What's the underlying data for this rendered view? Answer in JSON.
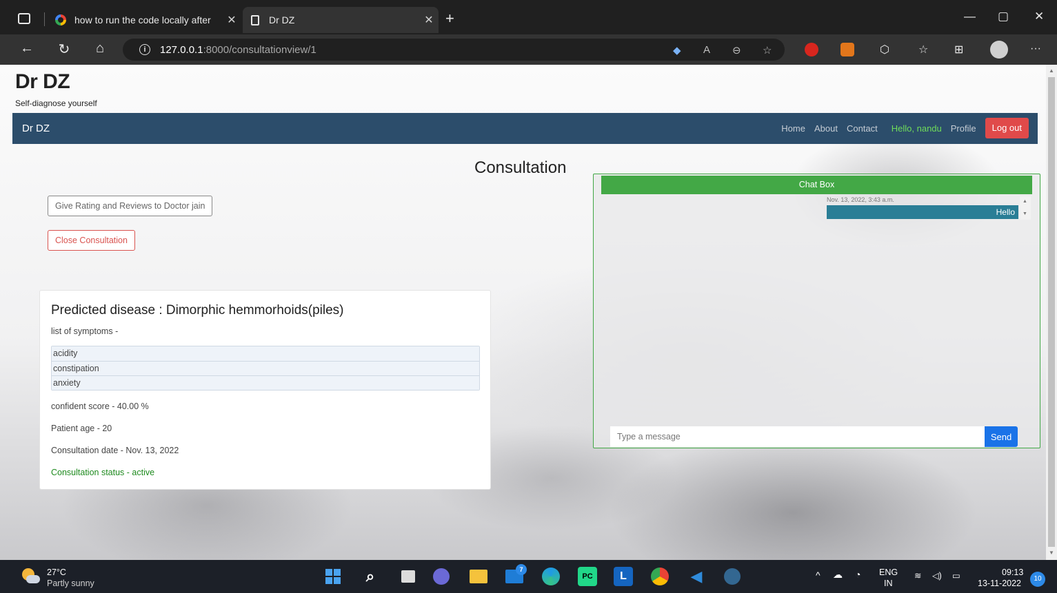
{
  "browser": {
    "tabs": [
      {
        "title": "how to run the code locally after",
        "icon": "google-icon"
      },
      {
        "title": "Dr DZ",
        "icon": "page-icon"
      }
    ],
    "url_host": "127.0.0.1",
    "url_rest": ":8000/consultationview/1"
  },
  "site": {
    "brand": "Dr DZ",
    "tagline": "Self-diagnose yourself",
    "nav_brand": "Dr DZ",
    "nav": {
      "home": "Home",
      "about": "About",
      "contact": "Contact",
      "hello": "Hello, nandu",
      "profile": "Profile",
      "logout": "Log out"
    }
  },
  "main": {
    "heading": "Consultation",
    "rating_button": "Give Rating and Reviews to Doctor jain",
    "close_button": "Close Consultation",
    "card": {
      "title": "Predicted disease : Dimorphic hemmorhoids(piles)",
      "symptoms_label": "list of symptoms -",
      "symptoms": [
        "acidity",
        "constipation",
        "anxiety"
      ],
      "score": "confident score - 40.00 %",
      "age": "Patient age - 20",
      "date": "Consultation date - Nov. 13, 2022",
      "status": "Consultation status - active"
    }
  },
  "chat": {
    "title": "Chat Box",
    "messages": [
      {
        "time": "Nov. 13, 2022, 3:43 a.m.",
        "text": "Hello"
      }
    ],
    "input_placeholder": "Type a message",
    "send_label": "Send",
    "header_color": "#43a846",
    "bubble_color": "#2a7e96"
  },
  "taskbar": {
    "temperature": "27°C",
    "weather": "Partly sunny",
    "lang": "ENG",
    "region": "IN",
    "time": "09:13",
    "date": "13-11-2022",
    "notifications": "10",
    "mail_badge": "7"
  },
  "colors": {
    "navbar": "#2c4d6b",
    "logout": "#e04a4a",
    "hello": "#6fdc5a",
    "status_active": "#1e8a1e"
  }
}
